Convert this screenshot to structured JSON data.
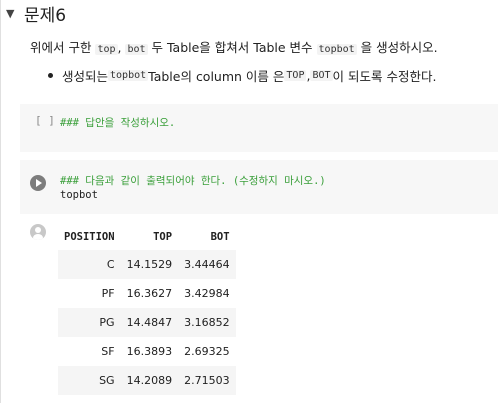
{
  "section": {
    "title": "문제6"
  },
  "instructions": {
    "line1": {
      "before": "위에서 구한 ",
      "code1": "top",
      "mid1": ", ",
      "code2": "bot",
      "after": " 두 Table을 합쳐서 Table 변수 ",
      "code3": "topbot",
      "end": " 을 생성하시오."
    },
    "bullet": {
      "before": "생성되는 ",
      "code1": "topbot",
      "mid": " Table의 column 이름 은 ",
      "code2": "TOP",
      "sep": ", ",
      "code3": "BOT",
      "end": " 이 되도록 수정한다."
    }
  },
  "cell1": {
    "prompt": "[ ]",
    "comment": "### 답안을 작성하시오."
  },
  "cell2": {
    "comment": "### 다음과 같이 출력되어야 한다. (수정하지 마시오.)",
    "code": "topbot"
  },
  "output_table": {
    "headers": [
      "POSITION",
      "TOP",
      "BOT"
    ],
    "rows": [
      [
        "C",
        "14.1529",
        "3.44464"
      ],
      [
        "PF",
        "16.3627",
        "3.42984"
      ],
      [
        "PG",
        "14.4847",
        "3.16852"
      ],
      [
        "SF",
        "16.3893",
        "2.69325"
      ],
      [
        "SG",
        "14.2089",
        "2.71503"
      ]
    ]
  },
  "icons": {
    "collapse": "caret-down-icon",
    "run": "play-circle-icon",
    "output": "user-avatar-icon"
  },
  "colors": {
    "comment": "#3a9f3a",
    "cell_bg": "#f7f7f7",
    "row_stripe": "#f5f5f5"
  }
}
